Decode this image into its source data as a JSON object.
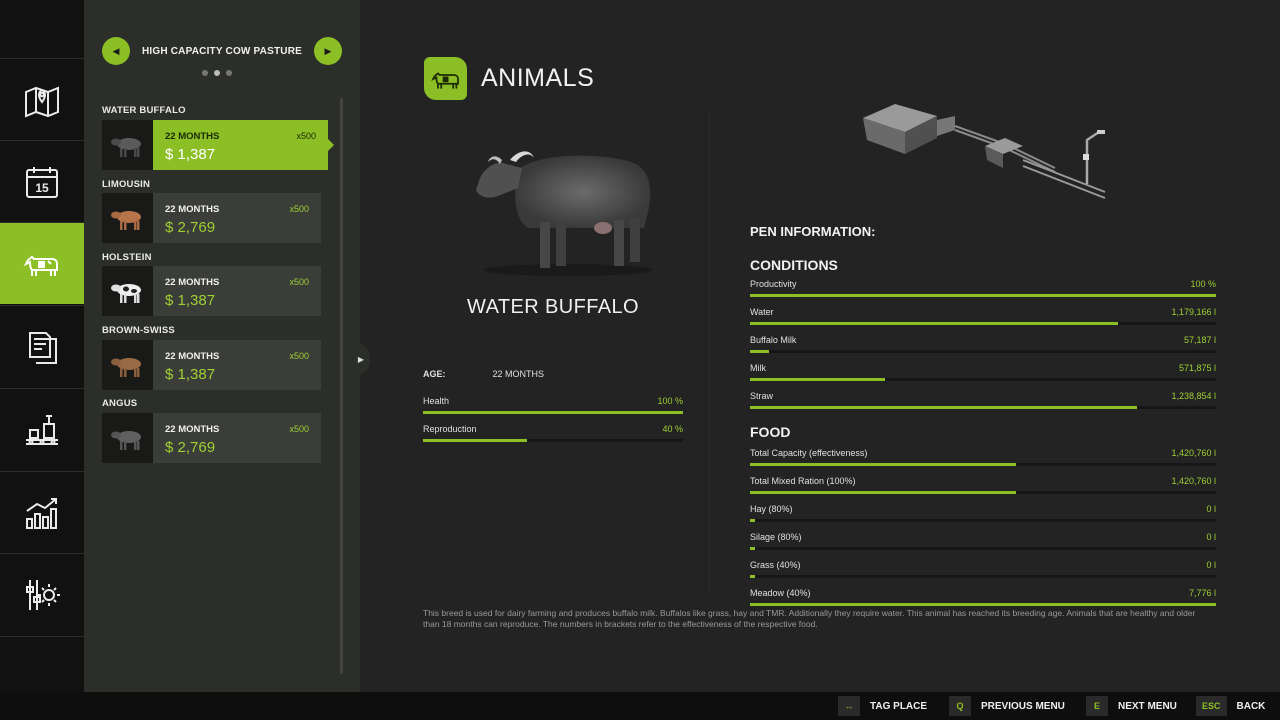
{
  "pasture": {
    "name": "HIGH CAPACITY COW PASTURE",
    "prev_icon": "triangle-left",
    "next_icon": "triangle-right",
    "page_count": 3,
    "page_active": 2
  },
  "sidebar_nav": [
    {
      "name": "map",
      "icon": "map-pin-icon"
    },
    {
      "name": "calendar",
      "icon": "calendar-icon",
      "text": "15"
    },
    {
      "name": "animals",
      "icon": "cow-icon",
      "active": true
    },
    {
      "name": "contracts",
      "icon": "documents-icon"
    },
    {
      "name": "production",
      "icon": "factory-icon"
    },
    {
      "name": "statistics",
      "icon": "bar-chart-icon"
    },
    {
      "name": "settings",
      "icon": "gear-sliders-icon"
    }
  ],
  "animals_list": [
    {
      "category": "WATER BUFFALO",
      "age": "22 MONTHS",
      "price": "$ 1,387",
      "qty": "x500",
      "selected": true,
      "color": "#4a4a4a"
    },
    {
      "category": "LIMOUSIN",
      "age": "22 MONTHS",
      "price": "$ 2,769",
      "qty": "x500",
      "color": "#b7744a"
    },
    {
      "category": "HOLSTEIN",
      "age": "22 MONTHS",
      "price": "$ 1,387",
      "qty": "x500",
      "color": "#e8e8e8"
    },
    {
      "category": "BROWN-SWISS",
      "age": "22 MONTHS",
      "price": "$ 1,387",
      "qty": "x500",
      "color": "#9a6a44"
    },
    {
      "category": "ANGUS",
      "age": "22 MONTHS",
      "price": "$ 2,769",
      "qty": "x500",
      "color": "#555555"
    }
  ],
  "header": {
    "title": "ANIMALS",
    "icon": "cow-icon"
  },
  "detail": {
    "name": "WATER BUFFALO",
    "age_label": "AGE:",
    "age_value": "22 MONTHS",
    "stats": [
      {
        "label": "Health",
        "value": "100 %",
        "level": 1.0
      },
      {
        "label": "Reproduction",
        "value": "40 %",
        "level": 0.4
      }
    ],
    "description": "This breed is used for dairy farming and produces buffalo milk. Buffalos like grass, hay and TMR. Additionally they require water. This animal has reached its breeding age. Animals that are healthy and older than 18 months can reproduce. The numbers in brackets refer to the effectiveness of the respective food."
  },
  "pen": {
    "title": "PEN INFORMATION:",
    "conditions_title": "CONDITIONS",
    "conditions": [
      {
        "label": "Productivity",
        "value": "100 %",
        "level": 1.0
      },
      {
        "label": "Water",
        "value": "1,179,166 l",
        "level": 0.79
      },
      {
        "label": "Buffalo Milk",
        "value": "57,187 l",
        "level": 0.04
      },
      {
        "label": "Milk",
        "value": "571,875 l",
        "level": 0.29
      },
      {
        "label": "Straw",
        "value": "1,238,854 l",
        "level": 0.83
      }
    ],
    "food_title": "FOOD",
    "food": [
      {
        "label": "Total Capacity (effectiveness)",
        "value": "1,420,760 l",
        "level": 0.57
      },
      {
        "label": "Total Mixed Ration (100%)",
        "value": "1,420,760 l",
        "level": 0.57
      },
      {
        "label": "Hay (80%)",
        "value": "0 l",
        "level": 0.01
      },
      {
        "label": "Silage (80%)",
        "value": "0 l",
        "level": 0.01
      },
      {
        "label": "Grass (40%)",
        "value": "0 l",
        "level": 0.01
      },
      {
        "label": "Meadow (40%)",
        "value": "7,776 l",
        "level": 1.0
      }
    ]
  },
  "hints": [
    {
      "key": "↔",
      "label": "TAG PLACE"
    },
    {
      "key": "Q",
      "label": "PREVIOUS MENU"
    },
    {
      "key": "E",
      "label": "NEXT MENU"
    },
    {
      "key": "ESC",
      "label": "BACK"
    }
  ],
  "colors": {
    "accent": "#8cbf26",
    "value_text": "#9fd034",
    "panel": "#2b2e29"
  }
}
